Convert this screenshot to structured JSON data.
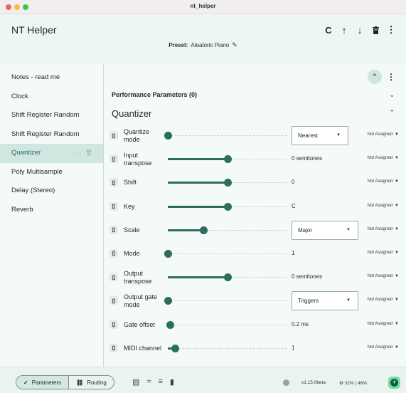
{
  "window": {
    "title": "nt_helper"
  },
  "app": {
    "title": "NT Helper",
    "actions": [
      {
        "name": "refresh-icon",
        "glyph": "C"
      },
      {
        "name": "arrow-up-icon",
        "glyph": "↑"
      },
      {
        "name": "arrow-down-icon",
        "glyph": "↓"
      },
      {
        "name": "delete-icon",
        "glyph": "🗑"
      },
      {
        "name": "more-vert-icon",
        "glyph": "⋮"
      }
    ],
    "preset_label": "Preset:",
    "preset_name": "Aleatoric Piano"
  },
  "sidebar": {
    "items": [
      {
        "label": "Notes - read me"
      },
      {
        "label": "Clock"
      },
      {
        "label": "Shift Register Random"
      },
      {
        "label": "Shift Register Random"
      },
      {
        "label": "Quantizer",
        "active": true
      },
      {
        "label": "Poly Multisample"
      },
      {
        "label": "Delay (Stereo)"
      },
      {
        "label": "Reverb"
      }
    ]
  },
  "main": {
    "performance_title": "Performance Parameters (0)",
    "section_title": "Quantizer",
    "assign_label": "Not Assigned",
    "params": [
      {
        "name": "Quantize mode",
        "kind": "select",
        "value": "Nearest",
        "level": 0.0
      },
      {
        "name": "Input transpose",
        "kind": "value",
        "value": "0 semitones",
        "level": 0.5
      },
      {
        "name": "Shift",
        "kind": "value",
        "value": "0",
        "level": 0.5
      },
      {
        "name": "Key",
        "kind": "value",
        "value": "C",
        "level": 0.5
      },
      {
        "name": "Scale",
        "kind": "select",
        "value": "Major",
        "level": 0.3
      },
      {
        "name": "Mode",
        "kind": "value",
        "value": "1",
        "level": 0.0
      },
      {
        "name": "Output transpose",
        "kind": "value",
        "value": "0 semitones",
        "level": 0.5
      },
      {
        "name": "Output gate mode",
        "kind": "select",
        "value": "Triggers",
        "level": 0.0
      },
      {
        "name": "Gate offset",
        "kind": "value",
        "value": "0.2 ms",
        "level": 0.02
      },
      {
        "name": "MIDI channel",
        "kind": "value",
        "value": "1",
        "level": 0.06
      }
    ]
  },
  "bottom": {
    "tab_parameters": "Parameters",
    "tab_routing": "Routing",
    "version": "v1.15.0beta",
    "cpu": "32% | 46%"
  },
  "colors": {
    "accent": "#2e6b60",
    "selected": "#cfe7e0",
    "fab": "#6ee0a6"
  }
}
